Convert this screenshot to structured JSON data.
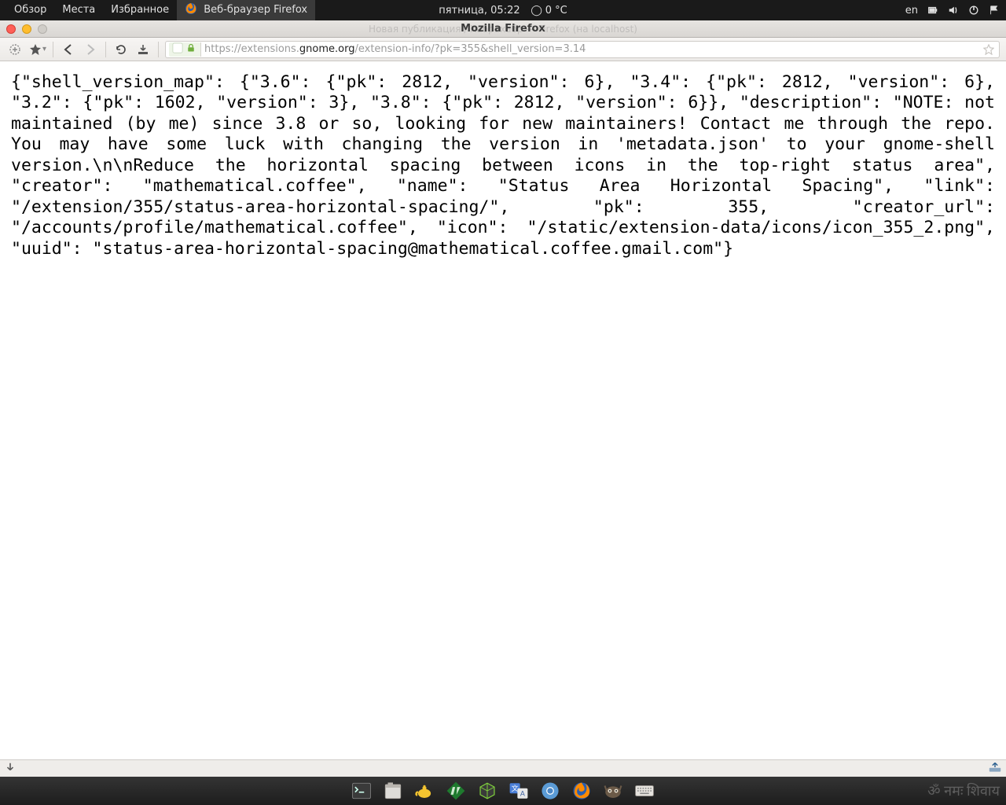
{
  "gnome_panel": {
    "left_menu": [
      "Обзор",
      "Места",
      "Избранное"
    ],
    "active_app": "Веб-браузер Firefox",
    "datetime": "пятница, 05:22",
    "temperature": "0 °C",
    "lang": "en"
  },
  "window": {
    "title": "Mozilla Firefox",
    "ghost_title": "Новая публикация / Хабрахабр — Firefox (на localhost)"
  },
  "toolbar": {
    "url_scheme": "https://",
    "url_sub": "extensions.",
    "url_host": "gnome.org",
    "url_path": "/extension-info/?pk=355&shell_version=3.14"
  },
  "page_content": {
    "json_text": "{\"shell_version_map\": {\"3.6\": {\"pk\": 2812, \"version\": 6}, \"3.4\": {\"pk\": 2812, \"version\": 6}, \"3.2\": {\"pk\": 1602, \"version\": 3}, \"3.8\": {\"pk\": 2812, \"version\": 6}}, \"description\": \"NOTE: not maintained (by me) since 3.8 or so, looking for new maintainers! Contact me through the repo. You may have some luck with changing the version in 'metadata.json' to your gnome-shell version.\\n\\nReduce the horizontal spacing between icons in the top-right status area\", \"creator\": \"mathematical.coffee\", \"name\": \"Status Area Horizontal Spacing\", \"link\": \"/extension/355/status-area-horizontal-spacing/\", \"pk\": 355, \"creator_url\": \"/accounts/profile/mathematical.coffee\", \"icon\": \"/static/extension-data/icons/icon_355_2.png\", \"uuid\": \"status-area-horizontal-spacing@mathematical.coffee.gmail.com\"}"
  },
  "dock": {
    "right_text": "ॐ नमः शिवाय"
  }
}
